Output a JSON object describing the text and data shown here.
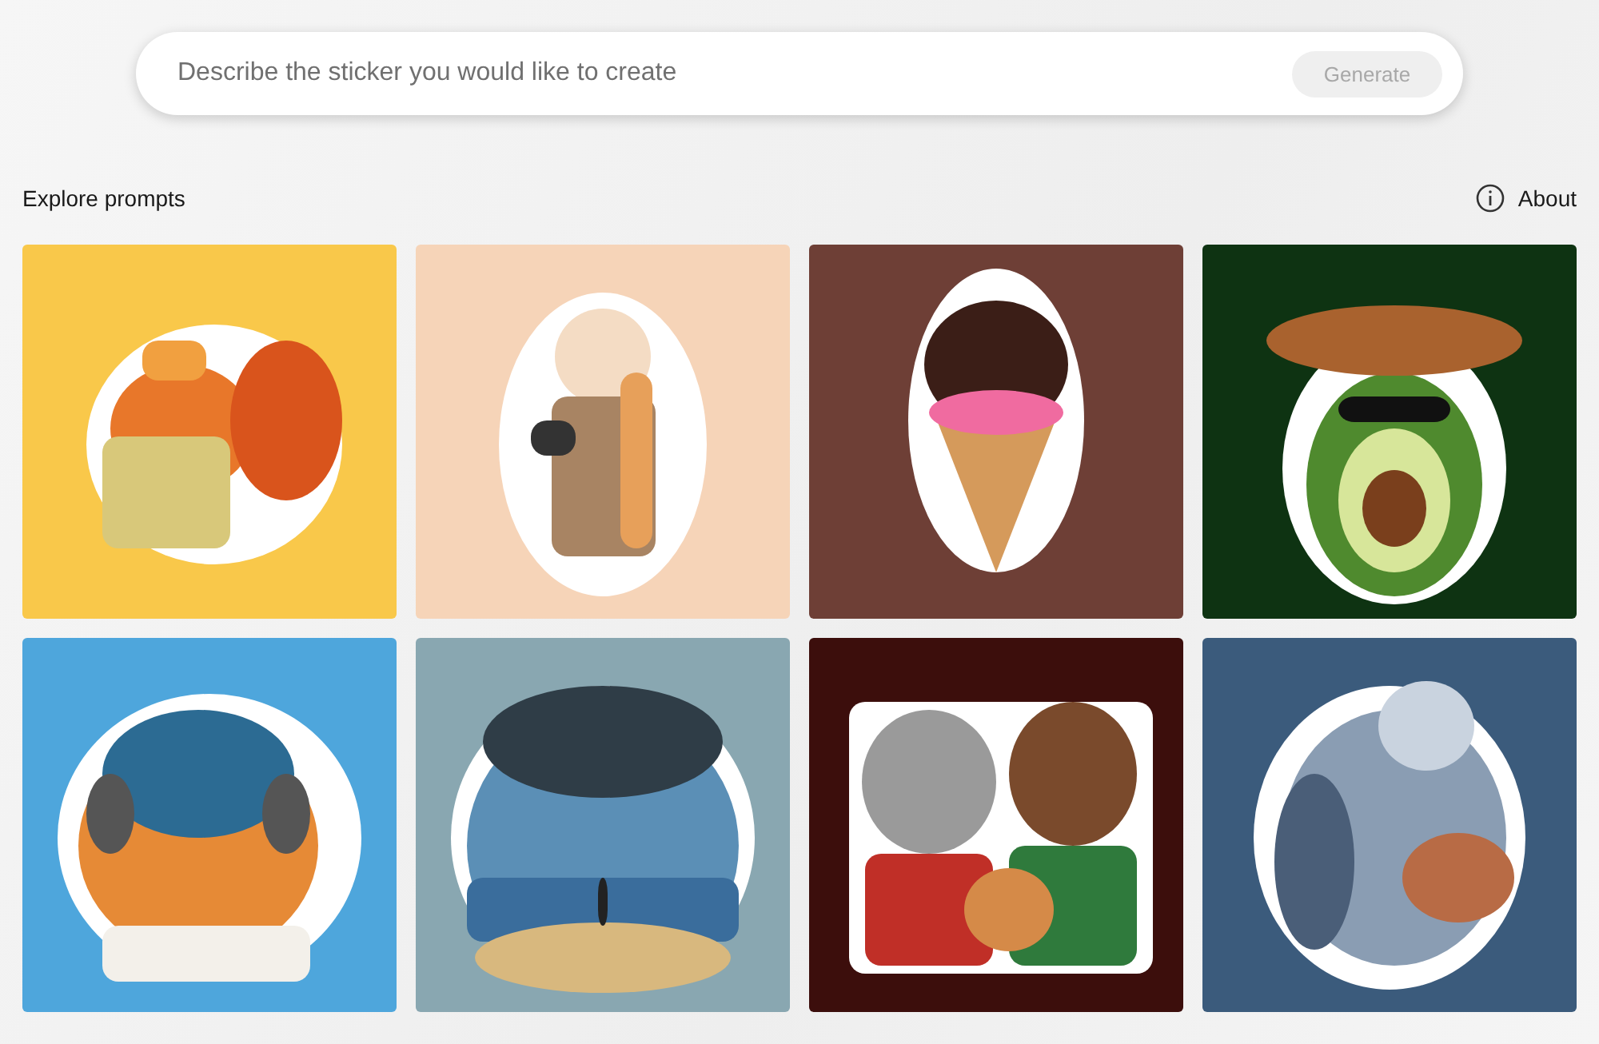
{
  "search": {
    "placeholder": "Describe the sticker you would like to create"
  },
  "generate_button": {
    "label": "Generate",
    "disabled": true
  },
  "section": {
    "title": "Explore prompts",
    "about_link": "About"
  }
}
